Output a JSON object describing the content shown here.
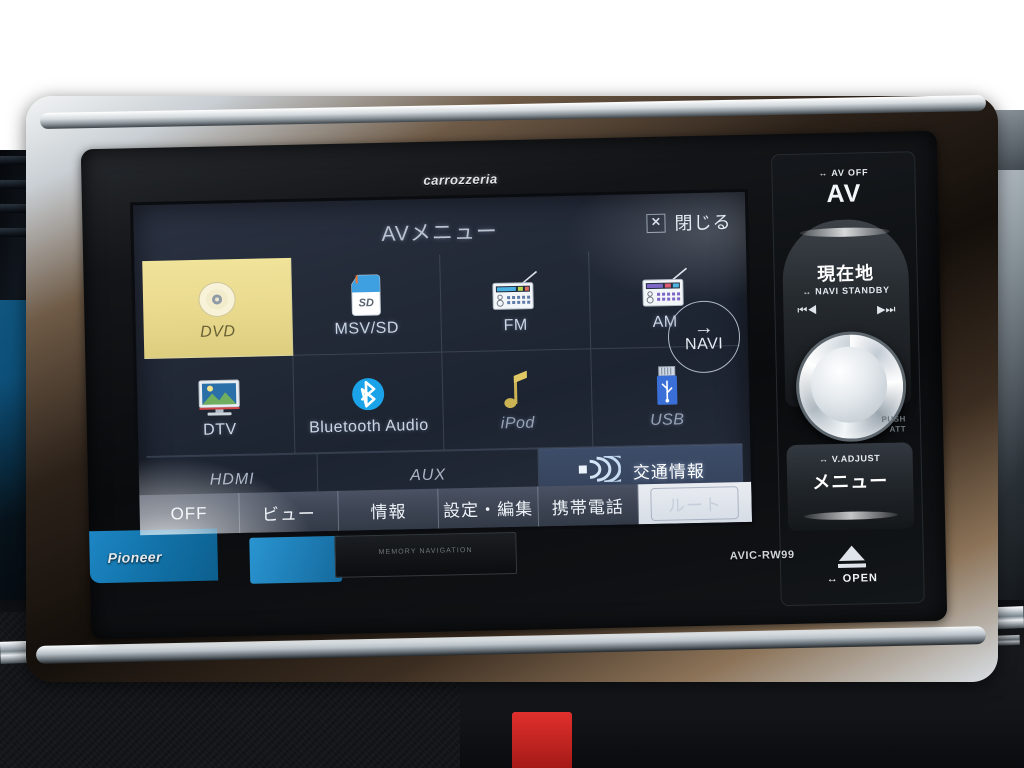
{
  "device": {
    "brand_top": "carrozzeria",
    "brand_bottom": "Pioneer",
    "model": "AVIC-RW99",
    "plate_text": "MEMORY NAVIGATION"
  },
  "screen": {
    "title": "AVメニュー",
    "close_label": "閉じる",
    "close_icon": "close-x-icon",
    "navi_button": {
      "label": "NAVI",
      "arrow": "→"
    },
    "sources": [
      {
        "id": "dvd",
        "label": "DVD",
        "icon": "disc-icon",
        "selected": true,
        "dim": false
      },
      {
        "id": "msv-sd",
        "label": "MSV/SD",
        "icon": "sd-card-icon",
        "selected": false,
        "dim": false
      },
      {
        "id": "fm",
        "label": "FM",
        "icon": "radio-icon",
        "selected": false,
        "dim": false
      },
      {
        "id": "am",
        "label": "AM",
        "icon": "radio-icon",
        "selected": false,
        "dim": false
      },
      {
        "id": "dtv",
        "label": "DTV",
        "icon": "tv-icon",
        "selected": false,
        "dim": false
      },
      {
        "id": "bluetooth",
        "label": "Bluetooth Audio",
        "icon": "bluetooth-icon",
        "selected": false,
        "dim": false
      },
      {
        "id": "ipod",
        "label": "iPod",
        "icon": "music-note-icon",
        "selected": false,
        "dim": true
      },
      {
        "id": "usb",
        "label": "USB",
        "icon": "usb-icon",
        "selected": false,
        "dim": true
      }
    ],
    "wide_sources": [
      {
        "id": "hdmi",
        "label": "HDMI",
        "highlight": false,
        "icon": ""
      },
      {
        "id": "aux",
        "label": "AUX",
        "highlight": false,
        "icon": ""
      },
      {
        "id": "traffic",
        "label": "交通情報",
        "highlight": true,
        "icon": "broadcast-signal-icon"
      }
    ],
    "taskbar": [
      {
        "id": "av-off",
        "label": "OFF"
      },
      {
        "id": "view",
        "label": "ビュー"
      },
      {
        "id": "info",
        "label": "情報"
      },
      {
        "id": "settings",
        "label": "設定・編集"
      },
      {
        "id": "phone",
        "label": "携帯電話"
      },
      {
        "id": "route",
        "label": "ルート"
      }
    ]
  },
  "hardkeys": {
    "av_off_label": "AV OFF",
    "av_label": "AV",
    "current_location_label": "現在地",
    "navi_standby_label": "NAVI STANDBY",
    "prev_track_icon": "previous-track-icon",
    "next_track_icon": "next-track-icon",
    "push_att_label": "PUSH\nATT",
    "push_line1": "PUSH",
    "push_line2": "ATT",
    "v_adjust_label": "V.ADJUST",
    "menu_label": "メニュー",
    "open_label": "OPEN",
    "volume_knob": "volume-knob"
  },
  "colors": {
    "selected_tile": "#e8d98c",
    "highlight_tile": "#3d4c68",
    "screen_bg": "#232a38",
    "taskbar_bg": "#3c4453",
    "bluetooth_blue": "#1aa3e8",
    "accent_blue": "#1374ab"
  }
}
